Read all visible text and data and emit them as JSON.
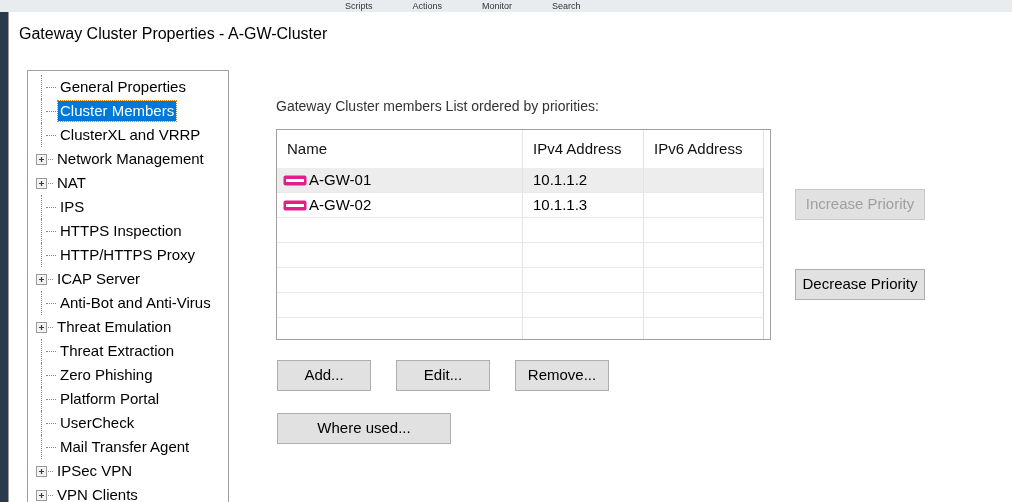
{
  "toolbar": [
    "Scripts",
    "Actions",
    "Monitor",
    "Search"
  ],
  "window": {
    "title": "Gateway Cluster Properties - A-GW-Cluster"
  },
  "tree": [
    {
      "label": "General Properties",
      "expandable": false,
      "selected": false
    },
    {
      "label": "Cluster Members",
      "expandable": false,
      "selected": true
    },
    {
      "label": "ClusterXL and VRRP",
      "expandable": false,
      "selected": false
    },
    {
      "label": "Network Management",
      "expandable": true,
      "selected": false
    },
    {
      "label": "NAT",
      "expandable": true,
      "selected": false
    },
    {
      "label": "IPS",
      "expandable": false,
      "selected": false
    },
    {
      "label": "HTTPS Inspection",
      "expandable": false,
      "selected": false
    },
    {
      "label": "HTTP/HTTPS Proxy",
      "expandable": false,
      "selected": false
    },
    {
      "label": "ICAP Server",
      "expandable": true,
      "selected": false
    },
    {
      "label": "Anti-Bot and Anti-Virus",
      "expandable": false,
      "selected": false
    },
    {
      "label": "Threat Emulation",
      "expandable": true,
      "selected": false
    },
    {
      "label": "Threat Extraction",
      "expandable": false,
      "selected": false
    },
    {
      "label": "Zero Phishing",
      "expandable": false,
      "selected": false
    },
    {
      "label": "Platform Portal",
      "expandable": false,
      "selected": false
    },
    {
      "label": "UserCheck",
      "expandable": false,
      "selected": false
    },
    {
      "label": "Mail Transfer Agent",
      "expandable": false,
      "selected": false
    },
    {
      "label": "IPSec VPN",
      "expandable": true,
      "selected": false
    },
    {
      "label": "VPN Clients",
      "expandable": true,
      "selected": false
    }
  ],
  "members_label": "Gateway Cluster members List ordered by priorities:",
  "table": {
    "columns": [
      "Name",
      "IPv4 Address",
      "IPv6 Address"
    ],
    "rows": [
      {
        "name": "A-GW-01",
        "ipv4": "10.1.1.2",
        "selected": true
      },
      {
        "name": "A-GW-02",
        "ipv4": "10.1.1.3",
        "selected": false
      }
    ]
  },
  "priority_buttons": [
    {
      "label": "Increase Priority",
      "disabled": true
    },
    {
      "label": "Decrease Priority",
      "disabled": false
    }
  ],
  "action_buttons": [
    {
      "label": "Add..."
    },
    {
      "label": "Edit..."
    },
    {
      "label": "Remove..."
    }
  ],
  "where_used_button": {
    "label": "Where used..."
  }
}
